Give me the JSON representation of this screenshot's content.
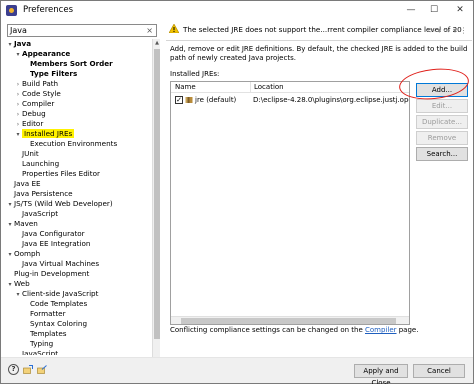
{
  "window": {
    "title": "Preferences",
    "min": "—",
    "max": "☐",
    "close": "✕"
  },
  "filter": {
    "value": "Java",
    "clear": "×"
  },
  "tree": [
    {
      "label": "Java",
      "indent": 0,
      "twisty": "▾",
      "bold": true
    },
    {
      "label": "Appearance",
      "indent": 1,
      "twisty": "▾",
      "bold": true
    },
    {
      "label": "Members Sort Order",
      "indent": 2,
      "twisty": "",
      "bold": true
    },
    {
      "label": "Type Filters",
      "indent": 2,
      "twisty": "",
      "bold": true
    },
    {
      "label": "Build Path",
      "indent": 1,
      "twisty": "›",
      "bold": false
    },
    {
      "label": "Code Style",
      "indent": 1,
      "twisty": "›",
      "bold": false
    },
    {
      "label": "Compiler",
      "indent": 1,
      "twisty": "›",
      "bold": false
    },
    {
      "label": "Debug",
      "indent": 1,
      "twisty": "›",
      "bold": false
    },
    {
      "label": "Editor",
      "indent": 1,
      "twisty": "›",
      "bold": false
    },
    {
      "label": "Installed JREs",
      "indent": 1,
      "twisty": "▾",
      "bold": false,
      "highlight": true
    },
    {
      "label": "Execution Environments",
      "indent": 2,
      "twisty": "",
      "bold": false
    },
    {
      "label": "JUnit",
      "indent": 1,
      "twisty": "",
      "bold": false
    },
    {
      "label": "Launching",
      "indent": 1,
      "twisty": "",
      "bold": false
    },
    {
      "label": "Properties Files Editor",
      "indent": 1,
      "twisty": "",
      "bold": false
    },
    {
      "label": "Java EE",
      "indent": 0,
      "twisty": "",
      "bold": false
    },
    {
      "label": "Java Persistence",
      "indent": 0,
      "twisty": "",
      "bold": false
    },
    {
      "label": "JS/TS (Wild Web Developer)",
      "indent": 0,
      "twisty": "▾",
      "bold": false
    },
    {
      "label": "JavaScript",
      "indent": 1,
      "twisty": "",
      "bold": false
    },
    {
      "label": "Maven",
      "indent": 0,
      "twisty": "▾",
      "bold": false
    },
    {
      "label": "Java Configurator",
      "indent": 1,
      "twisty": "",
      "bold": false
    },
    {
      "label": "Java EE Integration",
      "indent": 1,
      "twisty": "",
      "bold": false
    },
    {
      "label": "Oomph",
      "indent": 0,
      "twisty": "▾",
      "bold": false
    },
    {
      "label": "Java Virtual Machines",
      "indent": 1,
      "twisty": "",
      "bold": false
    },
    {
      "label": "Plug-in Development",
      "indent": 0,
      "twisty": "",
      "bold": false
    },
    {
      "label": "Web",
      "indent": 0,
      "twisty": "▾",
      "bold": false
    },
    {
      "label": "Client-side JavaScript",
      "indent": 1,
      "twisty": "▾",
      "bold": false
    },
    {
      "label": "Code Templates",
      "indent": 2,
      "twisty": "",
      "bold": false
    },
    {
      "label": "Formatter",
      "indent": 2,
      "twisty": "",
      "bold": false
    },
    {
      "label": "Syntax Coloring",
      "indent": 2,
      "twisty": "",
      "bold": false
    },
    {
      "label": "Templates",
      "indent": 2,
      "twisty": "",
      "bold": false
    },
    {
      "label": "Typing",
      "indent": 2,
      "twisty": "",
      "bold": false
    },
    {
      "label": "JavaScript",
      "indent": 1,
      "twisty": "",
      "bold": false
    }
  ],
  "warning": "The selected JRE does not support the...rrent compiler compliance level of 20",
  "nav": {
    "back": "⇦ ▾",
    "fwd": "⇨ ▾",
    "menu": "⋮"
  },
  "description": "Add, remove or edit JRE definitions. By default, the checked JRE is added to the build path of newly created Java projects.",
  "installed_label": "Installed JREs:",
  "table": {
    "col_name": "Name",
    "col_location": "Location",
    "rows": [
      {
        "checked": "✓",
        "name": "jre (default)",
        "location": "D:\\eclipse-4.28.0\\plugins\\org.eclipse.justj.openjdk.h"
      }
    ]
  },
  "buttons": {
    "add": "Add...",
    "edit": "Edit...",
    "duplicate": "Duplicate...",
    "remove": "Remove",
    "search": "Search..."
  },
  "compliance": {
    "before": "Conflicting compliance settings can be changed on the ",
    "link": "Compiler",
    "after": " page."
  },
  "bottom": {
    "help": "?",
    "apply_close": "Apply and Close",
    "cancel": "Cancel"
  },
  "colors": {
    "highlight": "#fff200",
    "annotation": "#e0201b",
    "link": "#1f5fbf"
  }
}
